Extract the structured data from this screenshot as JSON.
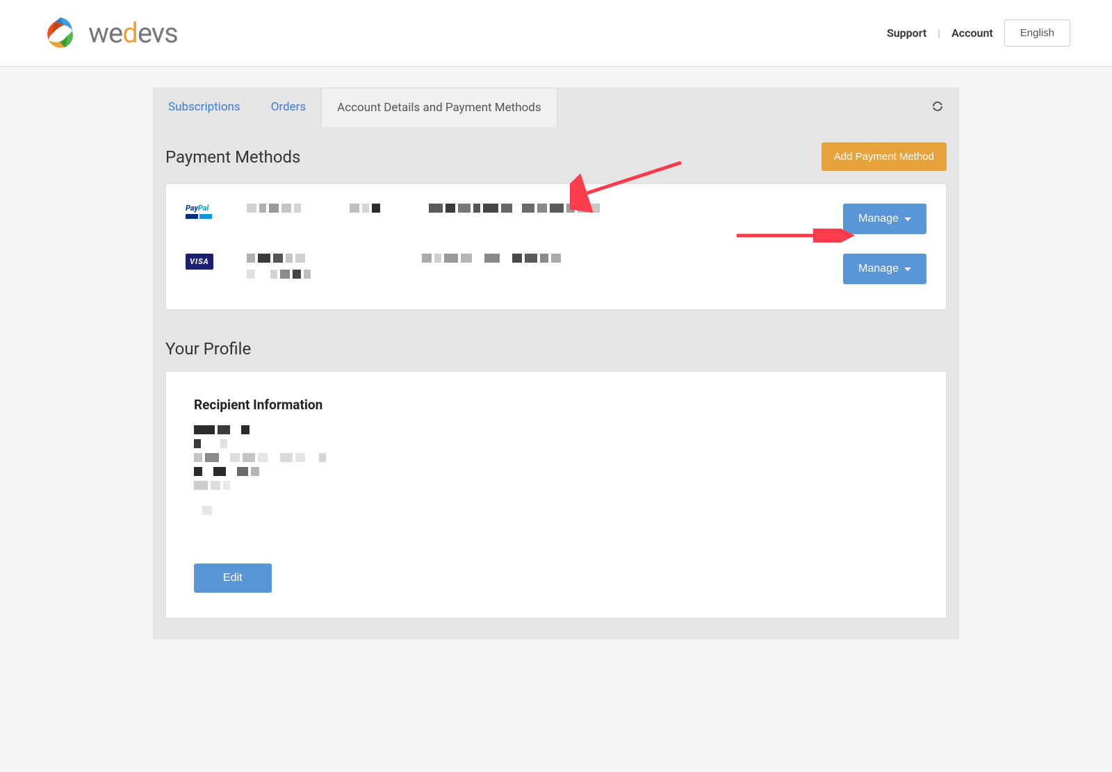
{
  "header": {
    "brand_prefix": "we",
    "brand_highlight": "d",
    "brand_suffix": "evs",
    "support": "Support",
    "account": "Account",
    "language": "English"
  },
  "tabs": {
    "subscriptions": "Subscriptions",
    "orders": "Orders",
    "account_details": "Account Details and Payment Methods"
  },
  "payment_methods": {
    "title": "Payment Methods",
    "add_button": "Add Payment Method",
    "manage_button": "Manage",
    "paypal_brand_pay": "Pay",
    "paypal_brand_pal": "Pal",
    "visa_brand": "VISA"
  },
  "profile": {
    "title": "Your Profile",
    "recipient_heading": "Recipient Information",
    "edit_button": "Edit"
  }
}
